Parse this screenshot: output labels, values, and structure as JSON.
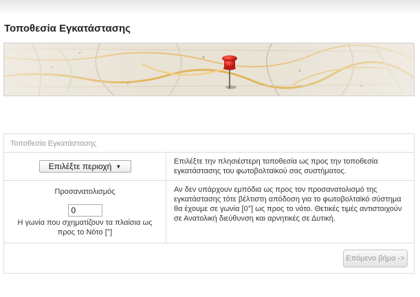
{
  "page": {
    "title": "Τοποθεσία Εγκατάστασης"
  },
  "banner": {
    "image": "map-with-red-pushpin",
    "pin_color": "#d7261c"
  },
  "panel": {
    "header": "Τοποθεσία Εγκατάστασης",
    "region_select": {
      "selected": "Επιλέξτε περιοχή"
    },
    "region_help": "Επιλέξτε την πλησιέστερη τοποθεσία ως προς την τοποθεσία εγκατάστασης του φωτοβολταϊκού σας συστήματος.",
    "orientation": {
      "label": "Προσανατολισμός",
      "value": "0",
      "caption": "Η γωνία που σχηματίζουν τα πλαίσια ως προς το Νότο [°]"
    },
    "orientation_help": "Αν δεν υπάρχουν εμπόδια ως προς τον προσανατολισμό της εγκατάστασης τότε βέλτιστη απόδοση για το φωτοβολταϊκό σύστημα θα έχουμε σε γωνία [0°] ως προς το νότο. Θετικές τιμές αντιστοιχούν σε Ανατολική διεύθυνση και αρνητικές σε Δυτική.",
    "next_button": "Επόμενο βήμα ->"
  }
}
